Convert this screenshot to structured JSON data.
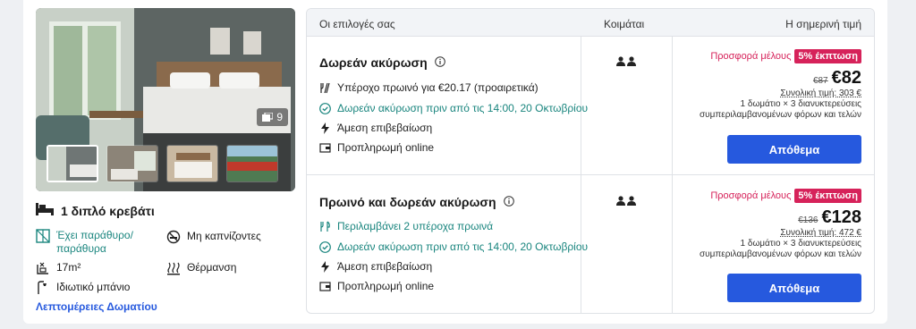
{
  "gallery": {
    "photo_count": "9"
  },
  "room": {
    "bed": "1 διπλό κρεβάτι",
    "amenities": [
      {
        "icon": "window-icon",
        "label": "Έχει παράθυρο/ παράθυρα"
      },
      {
        "icon": "no-smoking-icon",
        "label": "Μη καπνίζοντες"
      },
      {
        "icon": "room-size-icon",
        "label": "17m²"
      },
      {
        "icon": "heating-icon",
        "label": "Θέρμανση"
      },
      {
        "icon": "shower-icon",
        "label": "Ιδιωτικό μπάνιο"
      }
    ],
    "details_link": "Λεπτομέρειες Δωματίου"
  },
  "table": {
    "headers": {
      "options": "Οι επιλογές σας",
      "sleeps": "Κοιμάται",
      "price": "Η σημερινή τιμή"
    },
    "rates": [
      {
        "title": "Δωρεάν ακύρωση",
        "features": [
          {
            "icon": "breakfast-icon",
            "text": "Υπέροχο πρωινό για €20.17 (προαιρετικά)"
          },
          {
            "icon": "check-circle-icon",
            "text": "Δωρεάν ακύρωση πριν από τις 14:00, 20 Οκτωβρίου"
          },
          {
            "icon": "lightning-icon",
            "text": "Άμεση επιβεβαίωση"
          },
          {
            "icon": "wallet-icon",
            "text": "Προπληρωμή online"
          }
        ],
        "offer_label": "Προσφορά μέλους",
        "discount_badge": "5% έκπτωση",
        "old_price": "€87",
        "price": "€82",
        "total": "Συνολική τιμή: 303 €",
        "note_line1": "1 δωμάτιο × 3 διανυκτερεύσεις",
        "note_line2": "συμπεριλαμβανομένων φόρων και τελών",
        "button": "Απόθεμα"
      },
      {
        "title": "Πρωινό και δωρεάν ακύρωση",
        "features": [
          {
            "icon": "cutlery-icon",
            "text": "Περιλαμβάνει 2 υπέροχα πρωινά"
          },
          {
            "icon": "check-circle-icon",
            "text": "Δωρεάν ακύρωση πριν από τις 14:00, 20 Οκτωβρίου"
          },
          {
            "icon": "lightning-icon",
            "text": "Άμεση επιβεβαίωση"
          },
          {
            "icon": "wallet-icon",
            "text": "Προπληρωμή online"
          }
        ],
        "offer_label": "Προσφορά μέλους",
        "discount_badge": "5% έκπτωση",
        "old_price": "€136",
        "price": "€128",
        "total": "Συνολική τιμή: 472 €",
        "note_line1": "1 δωμάτιο × 3 διανυκτερεύσεις",
        "note_line2": "συμπεριλαμβανομένων φόρων και τελών",
        "button": "Απόθεμα"
      }
    ]
  },
  "colors": {
    "accent_blue": "#2659de",
    "promo_pink": "#d6225a",
    "teal": "#19857e"
  }
}
